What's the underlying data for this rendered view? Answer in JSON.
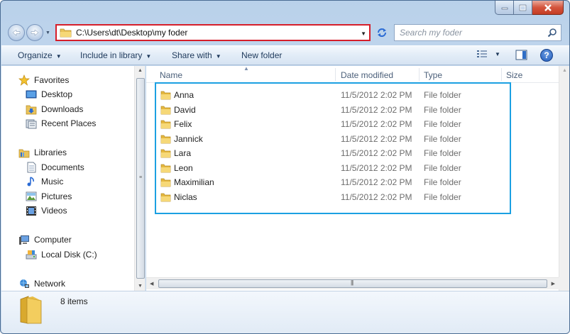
{
  "address": {
    "path": "C:\\Users\\dt\\Desktop\\my foder"
  },
  "search": {
    "placeholder": "Search my foder"
  },
  "toolbar": {
    "organize": "Organize",
    "include_in_library": "Include in library",
    "share_with": "Share with",
    "new_folder": "New folder"
  },
  "nav": {
    "favorites": "Favorites",
    "desktop": "Desktop",
    "downloads": "Downloads",
    "recent_places": "Recent Places",
    "libraries": "Libraries",
    "documents": "Documents",
    "music": "Music",
    "pictures": "Pictures",
    "videos": "Videos",
    "computer": "Computer",
    "local_disk": "Local Disk (C:)",
    "network": "Network"
  },
  "columns": {
    "name": "Name",
    "date_modified": "Date modified",
    "type": "Type",
    "size": "Size"
  },
  "files": [
    {
      "name": "Anna",
      "date": "11/5/2012 2:02 PM",
      "type": "File folder"
    },
    {
      "name": "David",
      "date": "11/5/2012 2:02 PM",
      "type": "File folder"
    },
    {
      "name": "Felix",
      "date": "11/5/2012 2:02 PM",
      "type": "File folder"
    },
    {
      "name": "Jannick",
      "date": "11/5/2012 2:02 PM",
      "type": "File folder"
    },
    {
      "name": "Lara",
      "date": "11/5/2012 2:02 PM",
      "type": "File folder"
    },
    {
      "name": "Leon",
      "date": "11/5/2012 2:02 PM",
      "type": "File folder"
    },
    {
      "name": "Maximilian",
      "date": "11/5/2012 2:02 PM",
      "type": "File folder"
    },
    {
      "name": "Niclas",
      "date": "11/5/2012 2:02 PM",
      "type": "File folder"
    }
  ],
  "status": {
    "item_count": "8 items"
  },
  "colors": {
    "address_highlight": "#d61e2a",
    "files_highlight": "#1ba0e2",
    "chrome": "#b9d1ea"
  }
}
